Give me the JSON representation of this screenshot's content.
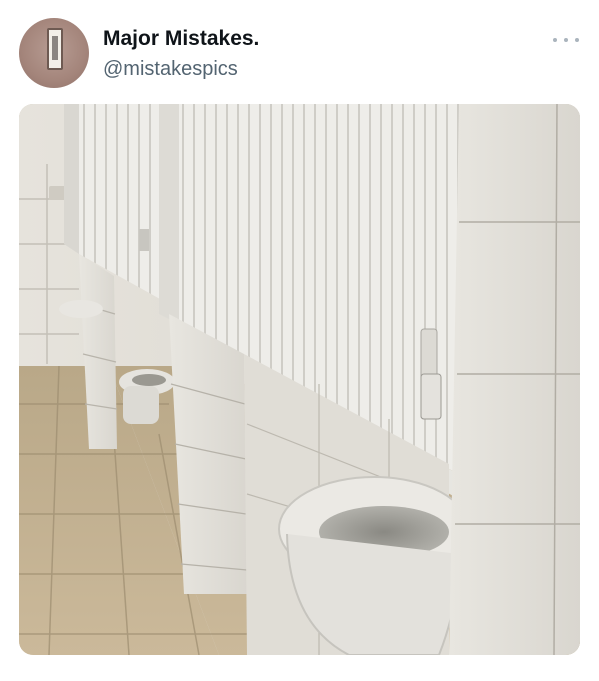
{
  "tweet": {
    "display_name": "Major Mistakes.",
    "handle": "@mistakespics",
    "avatar_icon": "window-photo-avatar",
    "more_icon": "more-options-icon",
    "media": {
      "subject": "photo of bathroom stalls with toilets extending beneath the partition walls"
    }
  },
  "colors": {
    "name_text": "#0f1419",
    "handle_text": "#536471",
    "more_dots": "#aab4bd"
  }
}
